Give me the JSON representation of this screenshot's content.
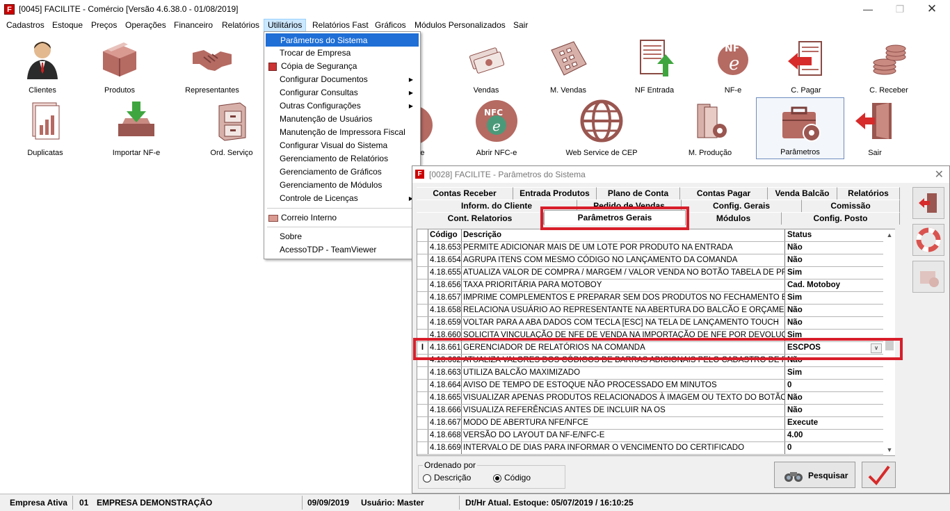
{
  "window": {
    "title": "[0045] FACILITE - Comércio [Versão 4.6.38.0 - 01/08/2019]"
  },
  "menubar": [
    "Cadastros",
    "Estoque",
    "Preços",
    "Operações",
    "Financeiro",
    "Relatórios",
    "Utilitários",
    "Relatórios Fast",
    "Gráficos",
    "Módulos Personalizados",
    "Sair"
  ],
  "desktop_row1": [
    "Clientes",
    "Produtos",
    "Representantes",
    "Vendas",
    "M. Vendas",
    "NF Entrada",
    "NF-e",
    "C. Pagar",
    "C. Receber"
  ],
  "desktop_row2": [
    "Duplicatas",
    "Importar NF-e",
    "Ord. Serviço",
    "Abrir NFC-e",
    "Web Service de CEP",
    "M. Produção",
    "Parâmetros",
    "Sair"
  ],
  "partial_labels": {
    "row1": "o",
    "row2": "F-e"
  },
  "utilitarios_menu": [
    "Parâmetros do Sistema",
    "Trocar de Empresa",
    "Cópia de Segurança",
    "Configurar Documentos",
    "Configurar Consultas",
    "Outras Configurações",
    "Manutenção de Usuários",
    "Manutenção de Impressora Fiscal",
    "Configurar Visual do Sistema",
    "Gerenciamento de Relatórios",
    "Gerenciamento de Gráficos",
    "Gerenciamento de Módulos",
    "Controle de Licenças",
    "Correio Interno",
    "Sobre",
    "AcessoTDP - TeamViewer"
  ],
  "dialog": {
    "title": "[0028] FACILITE - Parâmetros do Sistema",
    "tabs_row1": [
      "Contas Receber",
      "Entrada Produtos",
      "Plano de Conta",
      "Contas Pagar",
      "Venda Balcão",
      "Relatórios"
    ],
    "tabs_row2": [
      "Inform. do Cliente",
      "Pedido de Vendas",
      "Config. Gerais",
      "Comissão"
    ],
    "tabs_row3": [
      "Cont. Relatorios",
      "Parâmetros Gerais",
      "Módulos",
      "Config. Posto"
    ],
    "columns": [
      "Código",
      "Descrição",
      "Status"
    ],
    "rows": [
      {
        "code": "4.18.653",
        "desc": "PERMITE ADICIONAR MAIS DE UM LOTE POR PRODUTO NA ENTRADA",
        "status": "Não"
      },
      {
        "code": "4.18.654",
        "desc": "AGRUPA ITENS COM MESMO CÓDIGO NO LANÇAMENTO DA COMANDA",
        "status": "Não"
      },
      {
        "code": "4.18.655",
        "desc": "ATUALIZA VALOR DE COMPRA / MARGEM / VALOR VENDA NO BOTÃO TABELA DE PREÇOS",
        "status": "Sim"
      },
      {
        "code": "4.18.656",
        "desc": "TAXA PRIORITÁRIA PARA MOTOBOY",
        "status": "Cad. Motoboy"
      },
      {
        "code": "4.18.657",
        "desc": "IMPRIME COMPLEMENTOS E PREPARAR SEM DOS PRODUTOS NO FECHAMENTO E FINALIZAÇÃO",
        "status": "Sim"
      },
      {
        "code": "4.18.658",
        "desc": "RELACIONA USUÁRIO AO REPRESENTANTE NA ABERTURA DO BALCÃO E ORÇAMENTO",
        "status": "Não"
      },
      {
        "code": "4.18.659",
        "desc": "VOLTAR PARA A ABA DADOS COM TECLA [ESC] NA TELA DE LANÇAMENTO TOUCH",
        "status": "Não"
      },
      {
        "code": "4.18.660",
        "desc": "SOLICITA VINCULAÇÃO DE NFE DE VENDA NA IMPORTAÇÃO DE NFE POR DEVOLUÇÃO DE",
        "status": "Sim"
      },
      {
        "code": "4.18.661",
        "desc": "GERENCIADOR DE RELATÓRIOS NA COMANDA",
        "status": "ESCPOS"
      },
      {
        "code": "4.18.662",
        "desc": "ATUALIZA VALORES DOS CÓDIGOS DE BARRAS ADICIONAIS PELO CADASTRO DE PRODUTOS",
        "status": "Não"
      },
      {
        "code": "4.18.663",
        "desc": "UTILIZA BALCÃO MAXIMIZADO",
        "status": "Sim"
      },
      {
        "code": "4.18.664",
        "desc": "AVISO DE TEMPO DE ESTOQUE NÃO PROCESSADO EM MINUTOS",
        "status": "0"
      },
      {
        "code": "4.18.665",
        "desc": "VISUALIZAR APENAS PRODUTOS RELACIONADOS À IMAGEM OU TEXTO DO BOTÃO NA COMANDA",
        "status": "Não"
      },
      {
        "code": "4.18.666",
        "desc": "VISUALIZA REFERÊNCIAS ANTES DE INCLUIR NA OS",
        "status": "Não"
      },
      {
        "code": "4.18.667",
        "desc": "MODO DE ABERTURA NFE/NFCE",
        "status": "Execute"
      },
      {
        "code": "4.18.668",
        "desc": "VERSÃO DO LAYOUT DA NF-E/NFC-E",
        "status": "4.00"
      },
      {
        "code": "4.18.669",
        "desc": "INTERVALO DE DIAS PARA INFORMAR O VENCIMENTO DO CERTIFICADO",
        "status": "0"
      }
    ],
    "order_label": "Ordenado por",
    "order_desc": "Descrição",
    "order_code": "Código",
    "search_btn": "Pesquisar"
  },
  "status": {
    "label": "Empresa Ativa",
    "code": "01",
    "company": "EMPRESA DEMONSTRAÇÃO",
    "date": "09/09/2019",
    "user": "Usuário: Master",
    "stock": "Dt/Hr Atual. Estoque: 05/07/2019 / 16:10:25"
  }
}
